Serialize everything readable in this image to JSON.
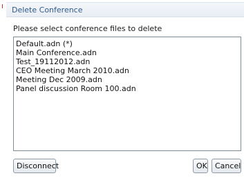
{
  "dialog": {
    "title": "Delete Conference",
    "prompt": "Please select conference files to delete"
  },
  "files": [
    "Default.adn (*)",
    "Main Conference.adn",
    "Test_19112012.adn",
    "CEO Meeting March 2010.adn",
    "Meeting Dec 2009.adn",
    "Panel discussion Room 100.adn"
  ],
  "buttons": {
    "disconnect": "Disconnect",
    "ok": "OK",
    "cancel": "Cancel"
  },
  "colors": {
    "title_text": "#2f5a8a",
    "title_bar": "#e9eef4",
    "border": "#7f8b96"
  }
}
